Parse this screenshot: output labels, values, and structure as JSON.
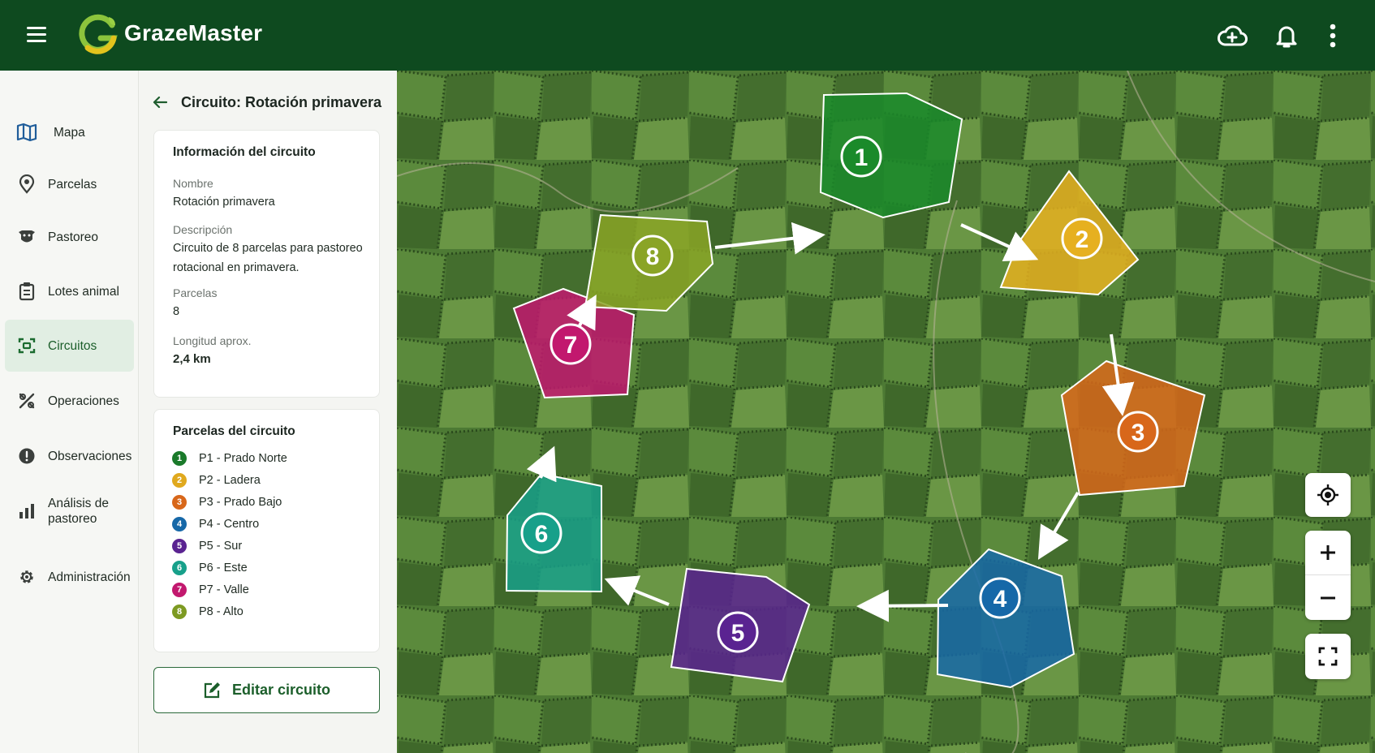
{
  "app": {
    "title": "GrazeMaster"
  },
  "topbar": {
    "icons": [
      "menu-icon",
      "cloud-sync-icon",
      "bell-icon",
      "more-vert-icon"
    ]
  },
  "sidebar": {
    "items": [
      {
        "label": "Mapa",
        "icon": "map-icon"
      },
      {
        "label": "Parcelas",
        "icon": "location-pin-icon"
      },
      {
        "label": "Pastoreo",
        "icon": "cow-icon"
      },
      {
        "label": "Lotes animal",
        "icon": "clipboard-icon"
      },
      {
        "label": "Circuitos",
        "icon": "circuit-icon",
        "active": true
      },
      {
        "label": "Operaciones",
        "icon": "tools-icon"
      },
      {
        "label": "Observaciones",
        "icon": "alert-icon"
      },
      {
        "label": "Análisis de pastoreo",
        "icon": "bar-chart-icon"
      },
      {
        "label": "Administración",
        "icon": "gear-icon"
      }
    ]
  },
  "panel": {
    "title": "Circuito: Rotación primavera",
    "info": {
      "heading": "Información del circuito",
      "name_label": "Nombre",
      "name_value": "Rotación primavera",
      "desc_label": "Descripción",
      "desc_value": "Circuito de 8 parcelas para pastoreo rotacional en primavera.",
      "plots_label": "Parcelas",
      "plots_value": "8",
      "length_label": "Longitud aprox.",
      "length_value": "2,4 km"
    },
    "plots": {
      "heading": "Parcelas del circuito",
      "items": [
        {
          "num": "1",
          "label": "P1 - Prado Norte",
          "color": "#1a7a2a"
        },
        {
          "num": "2",
          "label": "P2 - Ladera",
          "color": "#e0a91e"
        },
        {
          "num": "3",
          "label": "P3 - Prado Bajo",
          "color": "#d8671a"
        },
        {
          "num": "4",
          "label": "P4 - Centro",
          "color": "#1668a8"
        },
        {
          "num": "5",
          "label": "P5 - Sur",
          "color": "#5a2391"
        },
        {
          "num": "6",
          "label": "P6 - Este",
          "color": "#17a08a"
        },
        {
          "num": "7",
          "label": "P7 - Valle",
          "color": "#c2186e"
        },
        {
          "num": "8",
          "label": "P8 - Alto",
          "color": "#7d9a22"
        }
      ]
    },
    "edit_button": "Editar circuito"
  },
  "map": {
    "polygons": [
      {
        "num": "1",
        "color": "#1a8a2a"
      },
      {
        "num": "2",
        "color": "#e6b020"
      },
      {
        "num": "3",
        "color": "#d8671a"
      },
      {
        "num": "4",
        "color": "#1668a8"
      },
      {
        "num": "5",
        "color": "#5a2391"
      },
      {
        "num": "6",
        "color": "#17a08a"
      },
      {
        "num": "7",
        "color": "#c2186e"
      },
      {
        "num": "8",
        "color": "#8aa426"
      }
    ],
    "controls": [
      "my-location-icon",
      "zoom-in-icon",
      "zoom-out-icon",
      "fullscreen-icon"
    ]
  }
}
